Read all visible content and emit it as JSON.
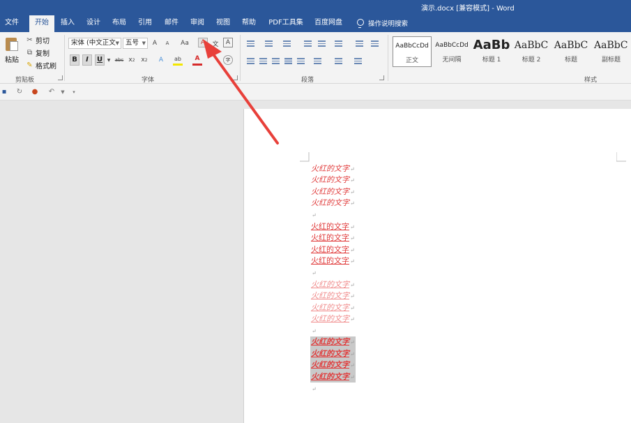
{
  "window": {
    "title": "演示.docx [兼容模式] - Word"
  },
  "tabs": [
    "文件",
    "开始",
    "插入",
    "设计",
    "布局",
    "引用",
    "邮件",
    "审阅",
    "视图",
    "帮助",
    "PDF工具集",
    "百度网盘"
  ],
  "tell_me": "操作说明搜索",
  "clipboard": {
    "paste": "粘贴",
    "cut": "剪切",
    "copy": "复制",
    "format_painter": "格式刷",
    "label": "剪贴板"
  },
  "font": {
    "font_name": "宋体 (中文正文",
    "font_size": "五号",
    "grow": "A",
    "shrink": "A",
    "change_case": "Aa",
    "clear_formatting": "A",
    "phonetic": "文",
    "border": "A",
    "bold": "B",
    "italic": "I",
    "underline": "U",
    "strikethrough": "abc",
    "subscript": "x",
    "superscript": "x",
    "text_effects": "A",
    "highlight": "ab",
    "font_color": "A",
    "enclose": "字",
    "label": "字体",
    "highlight_color": "#f3e600",
    "font_color_value": "#d62a2a"
  },
  "paragraph": {
    "label": "段落"
  },
  "styles": {
    "label": "样式",
    "items": [
      {
        "preview": "AaBbCcDd",
        "name": "正文"
      },
      {
        "preview": "AaBbCcDd",
        "name": "无间隔"
      },
      {
        "preview": "AaBb",
        "name": "标题 1"
      },
      {
        "preview": "AaBbC",
        "name": "标题 2"
      },
      {
        "preview": "AaBbC",
        "name": "标题"
      },
      {
        "preview": "AaBbC",
        "name": "副标题"
      }
    ]
  },
  "document": {
    "line_text": "火红的文字",
    "paragraph_mark": "↵",
    "text_color": "#e03a3a"
  },
  "annotation": {
    "arrow_color": "#e8403a"
  }
}
